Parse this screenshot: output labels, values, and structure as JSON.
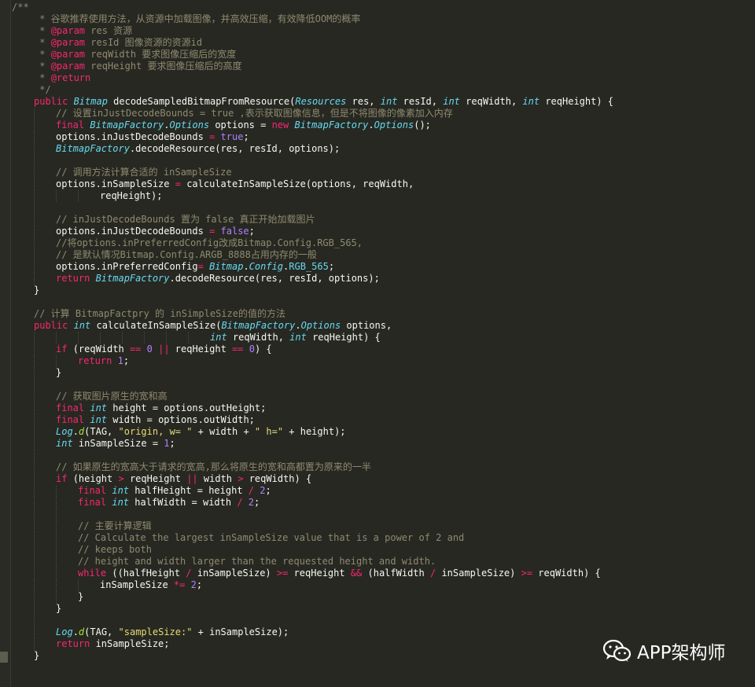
{
  "lines": [
    {
      "indent": 0,
      "tokens": [
        {
          "t": "/**",
          "c": "comment"
        }
      ]
    },
    {
      "indent": 1,
      "tokens": [
        {
          "t": " * 谷歌推荐使用方法，从资源中加载图像，并高效压缩，有效降低OOM的概率",
          "c": "comment"
        }
      ]
    },
    {
      "indent": 1,
      "tokens": [
        {
          "t": " * ",
          "c": "comment"
        },
        {
          "t": "@param",
          "c": "doctag"
        },
        {
          "t": " res 资源",
          "c": "comment"
        }
      ]
    },
    {
      "indent": 1,
      "tokens": [
        {
          "t": " * ",
          "c": "comment"
        },
        {
          "t": "@param",
          "c": "doctag"
        },
        {
          "t": " resId 图像资源的资源id",
          "c": "comment"
        }
      ]
    },
    {
      "indent": 1,
      "tokens": [
        {
          "t": " * ",
          "c": "comment"
        },
        {
          "t": "@param",
          "c": "doctag"
        },
        {
          "t": " reqWidth 要求图像压缩后的宽度",
          "c": "comment"
        }
      ]
    },
    {
      "indent": 1,
      "tokens": [
        {
          "t": " * ",
          "c": "comment"
        },
        {
          "t": "@param",
          "c": "doctag"
        },
        {
          "t": " reqHeight 要求图像压缩后的高度",
          "c": "comment"
        }
      ]
    },
    {
      "indent": 1,
      "tokens": [
        {
          "t": " * ",
          "c": "comment"
        },
        {
          "t": "@return",
          "c": "doctag"
        }
      ]
    },
    {
      "indent": 1,
      "tokens": [
        {
          "t": " */",
          "c": "comment"
        }
      ]
    },
    {
      "indent": 1,
      "tokens": [
        {
          "t": "public ",
          "c": "kw"
        },
        {
          "t": "Bitmap",
          "c": "type"
        },
        {
          "t": " decodeSampledBitmapFromResource(",
          "c": "plain"
        },
        {
          "t": "Resources",
          "c": "type"
        },
        {
          "t": " res, ",
          "c": "plain"
        },
        {
          "t": "int",
          "c": "type"
        },
        {
          "t": " resId, ",
          "c": "plain"
        },
        {
          "t": "int",
          "c": "type"
        },
        {
          "t": " reqWidth, ",
          "c": "plain"
        },
        {
          "t": "int",
          "c": "type"
        },
        {
          "t": " reqHeight) {",
          "c": "plain"
        }
      ]
    },
    {
      "indent": 2,
      "tokens": [
        {
          "t": "// 设置inJustDecodeBounds = true ,表示获取图像信息，但是不将图像的像素加入内存",
          "c": "comment"
        }
      ]
    },
    {
      "indent": 2,
      "tokens": [
        {
          "t": "final ",
          "c": "kw"
        },
        {
          "t": "BitmapFactory",
          "c": "type"
        },
        {
          "t": ".",
          "c": "plain"
        },
        {
          "t": "Options",
          "c": "type"
        },
        {
          "t": " options = ",
          "c": "plain"
        },
        {
          "t": "new ",
          "c": "kw"
        },
        {
          "t": "BitmapFactory",
          "c": "type"
        },
        {
          "t": ".",
          "c": "plain"
        },
        {
          "t": "Options",
          "c": "type"
        },
        {
          "t": "();",
          "c": "plain"
        }
      ]
    },
    {
      "indent": 2,
      "tokens": [
        {
          "t": "options.",
          "c": "plain"
        },
        {
          "t": "inJustDecodeBounds",
          "c": "plain"
        },
        {
          "t": " = ",
          "c": "op"
        },
        {
          "t": "true",
          "c": "num"
        },
        {
          "t": ";",
          "c": "plain"
        }
      ]
    },
    {
      "indent": 2,
      "tokens": [
        {
          "t": "BitmapFactory",
          "c": "type"
        },
        {
          "t": ".decodeResource(res, resId, options);",
          "c": "plain"
        }
      ]
    },
    {
      "indent": 2,
      "tokens": []
    },
    {
      "indent": 2,
      "tokens": [
        {
          "t": "// 调用方法计算合适的 inSampleSize",
          "c": "comment"
        }
      ]
    },
    {
      "indent": 2,
      "tokens": [
        {
          "t": "options.",
          "c": "plain"
        },
        {
          "t": "inSampleSize",
          "c": "plain"
        },
        {
          "t": " = ",
          "c": "op"
        },
        {
          "t": "calculateInSampleSize(options, reqWidth,",
          "c": "plain"
        }
      ]
    },
    {
      "indent": 4,
      "tokens": [
        {
          "t": "reqHeight);",
          "c": "plain"
        }
      ]
    },
    {
      "indent": 2,
      "tokens": []
    },
    {
      "indent": 2,
      "tokens": [
        {
          "t": "// inJustDecodeBounds 置为 false 真正开始加载图片",
          "c": "comment"
        }
      ]
    },
    {
      "indent": 2,
      "tokens": [
        {
          "t": "options.",
          "c": "plain"
        },
        {
          "t": "inJustDecodeBounds",
          "c": "plain"
        },
        {
          "t": " = ",
          "c": "op"
        },
        {
          "t": "false",
          "c": "num"
        },
        {
          "t": ";",
          "c": "plain"
        }
      ]
    },
    {
      "indent": 2,
      "tokens": [
        {
          "t": "//将options.inPreferredConfig改成Bitmap.Config.RGB_565,",
          "c": "comment"
        }
      ]
    },
    {
      "indent": 2,
      "tokens": [
        {
          "t": "// 是默认情况Bitmap.Config.ARGB_8888占用内存的一般",
          "c": "comment"
        }
      ]
    },
    {
      "indent": 2,
      "tokens": [
        {
          "t": "options.",
          "c": "plain"
        },
        {
          "t": "inPreferredConfig",
          "c": "plain"
        },
        {
          "t": "= ",
          "c": "op"
        },
        {
          "t": "Bitmap",
          "c": "type"
        },
        {
          "t": ".",
          "c": "plain"
        },
        {
          "t": "Config",
          "c": "type"
        },
        {
          "t": ".",
          "c": "plain"
        },
        {
          "t": "RGB_565",
          "c": "field"
        },
        {
          "t": ";",
          "c": "plain"
        }
      ]
    },
    {
      "indent": 2,
      "tokens": [
        {
          "t": "return ",
          "c": "kw"
        },
        {
          "t": "BitmapFactory",
          "c": "type"
        },
        {
          "t": ".decodeResource(res, resId, options);",
          "c": "plain"
        }
      ]
    },
    {
      "indent": 1,
      "tokens": [
        {
          "t": "}",
          "c": "plain"
        }
      ]
    },
    {
      "indent": 1,
      "tokens": []
    },
    {
      "indent": 1,
      "tokens": [
        {
          "t": "// 计算 BitmapFactpry 的 inSimpleSize的值的方法",
          "c": "comment"
        }
      ]
    },
    {
      "indent": 1,
      "tokens": [
        {
          "t": "public ",
          "c": "kw"
        },
        {
          "t": "int",
          "c": "type"
        },
        {
          "t": " calculateInSampleSize(",
          "c": "plain"
        },
        {
          "t": "BitmapFactory",
          "c": "type"
        },
        {
          "t": ".",
          "c": "plain"
        },
        {
          "t": "Options",
          "c": "type"
        },
        {
          "t": " options,",
          "c": "plain"
        }
      ]
    },
    {
      "indent": 9,
      "tokens": [
        {
          "t": "int",
          "c": "type"
        },
        {
          "t": " reqWidth, ",
          "c": "plain"
        },
        {
          "t": "int",
          "c": "type"
        },
        {
          "t": " reqHeight) {",
          "c": "plain"
        }
      ]
    },
    {
      "indent": 2,
      "tokens": [
        {
          "t": "if ",
          "c": "kw"
        },
        {
          "t": "(reqWidth ",
          "c": "plain"
        },
        {
          "t": "==",
          "c": "op"
        },
        {
          "t": " ",
          "c": "plain"
        },
        {
          "t": "0",
          "c": "num"
        },
        {
          "t": " ",
          "c": "plain"
        },
        {
          "t": "||",
          "c": "op"
        },
        {
          "t": " reqHeight ",
          "c": "plain"
        },
        {
          "t": "==",
          "c": "op"
        },
        {
          "t": " ",
          "c": "plain"
        },
        {
          "t": "0",
          "c": "num"
        },
        {
          "t": ") {",
          "c": "plain"
        }
      ]
    },
    {
      "indent": 3,
      "tokens": [
        {
          "t": "return ",
          "c": "kw"
        },
        {
          "t": "1",
          "c": "num"
        },
        {
          "t": ";",
          "c": "plain"
        }
      ]
    },
    {
      "indent": 2,
      "tokens": [
        {
          "t": "}",
          "c": "plain"
        }
      ]
    },
    {
      "indent": 2,
      "tokens": []
    },
    {
      "indent": 2,
      "tokens": [
        {
          "t": "// 获取图片原生的宽和高",
          "c": "comment"
        }
      ]
    },
    {
      "indent": 2,
      "tokens": [
        {
          "t": "final ",
          "c": "kw"
        },
        {
          "t": "int",
          "c": "type"
        },
        {
          "t": " height = options.",
          "c": "plain"
        },
        {
          "t": "outHeight",
          "c": "plain"
        },
        {
          "t": ";",
          "c": "plain"
        }
      ]
    },
    {
      "indent": 2,
      "tokens": [
        {
          "t": "final ",
          "c": "kw"
        },
        {
          "t": "int",
          "c": "type"
        },
        {
          "t": " width = options.",
          "c": "plain"
        },
        {
          "t": "outWidth",
          "c": "plain"
        },
        {
          "t": ";",
          "c": "plain"
        }
      ]
    },
    {
      "indent": 2,
      "tokens": [
        {
          "t": "Log",
          "c": "type"
        },
        {
          "t": ".",
          "c": "plain"
        },
        {
          "t": "d",
          "c": "ital"
        },
        {
          "t": "(TAG, ",
          "c": "plain"
        },
        {
          "t": "\"origin, w= \"",
          "c": "str"
        },
        {
          "t": " + width + ",
          "c": "plain"
        },
        {
          "t": "\" h=\"",
          "c": "str"
        },
        {
          "t": " + height);",
          "c": "plain"
        }
      ]
    },
    {
      "indent": 2,
      "tokens": [
        {
          "t": "int",
          "c": "type"
        },
        {
          "t": " inSampleSize = ",
          "c": "plain"
        },
        {
          "t": "1",
          "c": "num"
        },
        {
          "t": ";",
          "c": "plain"
        }
      ]
    },
    {
      "indent": 2,
      "tokens": []
    },
    {
      "indent": 2,
      "tokens": [
        {
          "t": "// 如果原生的宽高大于请求的宽高,那么将原生的宽和高都置为原来的一半",
          "c": "comment"
        }
      ]
    },
    {
      "indent": 2,
      "tokens": [
        {
          "t": "if ",
          "c": "kw"
        },
        {
          "t": "(height ",
          "c": "plain"
        },
        {
          "t": ">",
          "c": "op"
        },
        {
          "t": " reqHeight ",
          "c": "plain"
        },
        {
          "t": "||",
          "c": "op"
        },
        {
          "t": " width ",
          "c": "plain"
        },
        {
          "t": ">",
          "c": "op"
        },
        {
          "t": " reqWidth) {",
          "c": "plain"
        }
      ]
    },
    {
      "indent": 3,
      "tokens": [
        {
          "t": "final ",
          "c": "kw"
        },
        {
          "t": "int",
          "c": "type"
        },
        {
          "t": " halfHeight = height ",
          "c": "plain"
        },
        {
          "t": "/",
          "c": "op"
        },
        {
          "t": " ",
          "c": "plain"
        },
        {
          "t": "2",
          "c": "num"
        },
        {
          "t": ";",
          "c": "plain"
        }
      ]
    },
    {
      "indent": 3,
      "tokens": [
        {
          "t": "final ",
          "c": "kw"
        },
        {
          "t": "int",
          "c": "type"
        },
        {
          "t": " halfWidth = width ",
          "c": "plain"
        },
        {
          "t": "/",
          "c": "op"
        },
        {
          "t": " ",
          "c": "plain"
        },
        {
          "t": "2",
          "c": "num"
        },
        {
          "t": ";",
          "c": "plain"
        }
      ]
    },
    {
      "indent": 3,
      "tokens": []
    },
    {
      "indent": 3,
      "tokens": [
        {
          "t": "// 主要计算逻辑",
          "c": "comment"
        }
      ]
    },
    {
      "indent": 3,
      "tokens": [
        {
          "t": "// Calculate the largest inSampleSize value that is a power of 2 and",
          "c": "comment"
        }
      ]
    },
    {
      "indent": 3,
      "tokens": [
        {
          "t": "// keeps both",
          "c": "comment"
        }
      ]
    },
    {
      "indent": 3,
      "tokens": [
        {
          "t": "// height and width larger than the requested height and width.",
          "c": "comment"
        }
      ]
    },
    {
      "indent": 3,
      "tokens": [
        {
          "t": "while ",
          "c": "kw"
        },
        {
          "t": "((halfHeight ",
          "c": "plain"
        },
        {
          "t": "/",
          "c": "op"
        },
        {
          "t": " inSampleSize) ",
          "c": "plain"
        },
        {
          "t": ">=",
          "c": "op"
        },
        {
          "t": " reqHeight ",
          "c": "plain"
        },
        {
          "t": "&&",
          "c": "op"
        },
        {
          "t": " (halfWidth ",
          "c": "plain"
        },
        {
          "t": "/",
          "c": "op"
        },
        {
          "t": " inSampleSize) ",
          "c": "plain"
        },
        {
          "t": ">=",
          "c": "op"
        },
        {
          "t": " reqWidth) {",
          "c": "plain"
        }
      ]
    },
    {
      "indent": 4,
      "tokens": [
        {
          "t": "inSampleSize ",
          "c": "plain"
        },
        {
          "t": "*=",
          "c": "op"
        },
        {
          "t": " ",
          "c": "plain"
        },
        {
          "t": "2",
          "c": "num"
        },
        {
          "t": ";",
          "c": "plain"
        }
      ]
    },
    {
      "indent": 3,
      "tokens": [
        {
          "t": "}",
          "c": "plain"
        }
      ]
    },
    {
      "indent": 2,
      "tokens": [
        {
          "t": "}",
          "c": "plain"
        }
      ]
    },
    {
      "indent": 2,
      "tokens": []
    },
    {
      "indent": 2,
      "tokens": [
        {
          "t": "Log",
          "c": "type"
        },
        {
          "t": ".",
          "c": "plain"
        },
        {
          "t": "d",
          "c": "ital"
        },
        {
          "t": "(TAG, ",
          "c": "plain"
        },
        {
          "t": "\"sampleSize:\"",
          "c": "str"
        },
        {
          "t": " + inSampleSize);",
          "c": "plain"
        }
      ]
    },
    {
      "indent": 2,
      "tokens": [
        {
          "t": "return ",
          "c": "kw"
        },
        {
          "t": "inSampleSize;",
          "c": "plain"
        }
      ]
    },
    {
      "indent": 1,
      "tokens": [
        {
          "t": "}",
          "c": "plain"
        }
      ]
    }
  ],
  "watermark": {
    "icon": "wechat-icon",
    "text": "APP架构师"
  }
}
